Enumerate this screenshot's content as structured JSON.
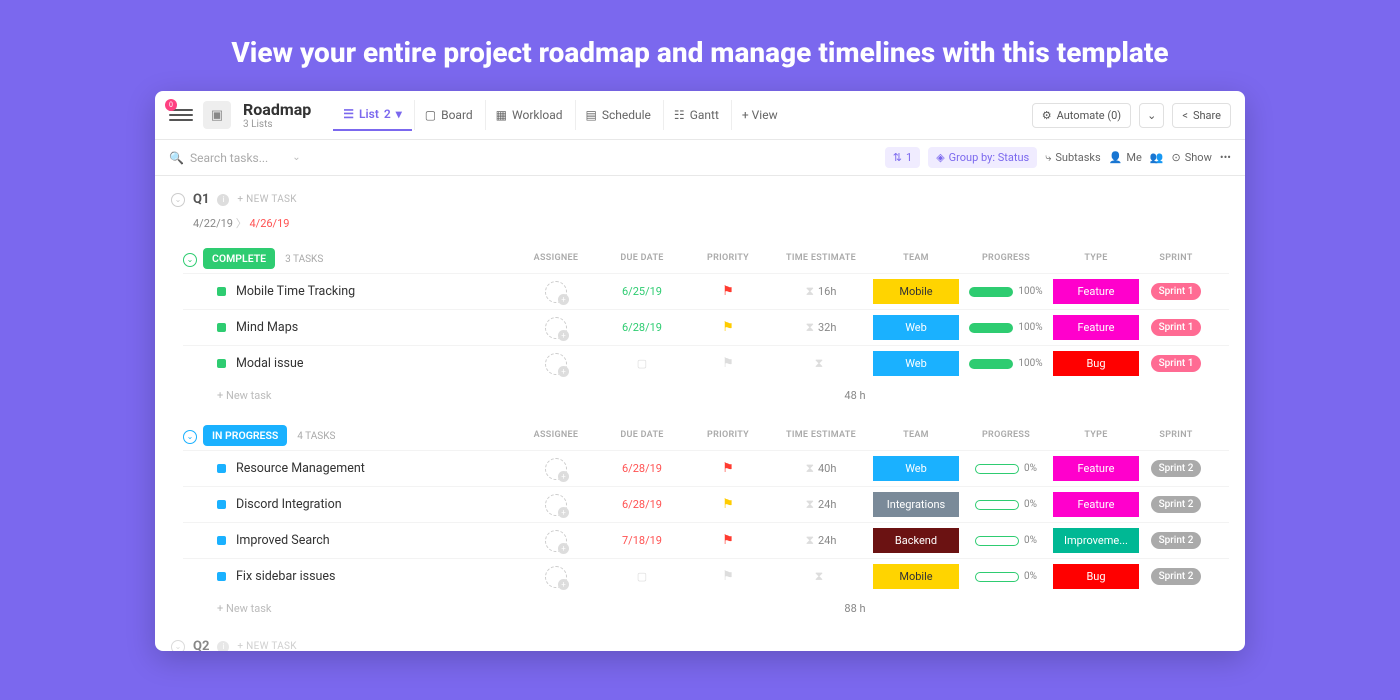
{
  "hero": "View your entire project roadmap and manage timelines with this template",
  "header": {
    "title": "Roadmap",
    "subtitle": "3 Lists",
    "views": {
      "list": "List",
      "list_n": "2",
      "board": "Board",
      "workload": "Workload",
      "schedule": "Schedule",
      "gantt": "Gantt",
      "add": "+ View"
    },
    "automate": "Automate (0)",
    "share": "Share"
  },
  "toolbar": {
    "search_placeholder": "Search tasks...",
    "filter_n": "1",
    "group_by": "Group by: Status",
    "subtasks": "Subtasks",
    "me": "Me",
    "show": "Show"
  },
  "columns": [
    "ASSIGNEE",
    "DUE DATE",
    "PRIORITY",
    "TIME ESTIMATE",
    "TEAM",
    "PROGRESS",
    "TYPE",
    "SPRINT"
  ],
  "q1": {
    "label": "Q1",
    "newtask": "+ NEW TASK",
    "date1": "4/22/19",
    "date2": "4/26/19"
  },
  "q2": {
    "label": "Q2",
    "newtask": "+ NEW TASK"
  },
  "groups": [
    {
      "status": "COMPLETE",
      "color": "green",
      "count": "3 TASKS",
      "total": "48 h",
      "tasks": [
        {
          "name": "Mobile Time Tracking",
          "due": "6/25/19",
          "due_cls": "",
          "flag": "red",
          "est": "16h",
          "team": "Mobile",
          "team_cls": "mobile",
          "prog": "100%",
          "prog_cls": "full",
          "type": "Feature",
          "type_cls": "type-feature",
          "sprint": "Sprint 1",
          "sprint_cls": "s1"
        },
        {
          "name": "Mind Maps",
          "due": "6/28/19",
          "due_cls": "",
          "flag": "yellow",
          "est": "32h",
          "team": "Web",
          "team_cls": "web",
          "prog": "100%",
          "prog_cls": "full",
          "type": "Feature",
          "type_cls": "type-feature",
          "sprint": "Sprint 1",
          "sprint_cls": "s1"
        },
        {
          "name": "Modal issue",
          "due": "",
          "due_cls": "none",
          "flag": "grey",
          "est": "",
          "team": "Web",
          "team_cls": "web",
          "prog": "100%",
          "prog_cls": "full",
          "type": "Bug",
          "type_cls": "type-bug",
          "sprint": "Sprint 1",
          "sprint_cls": "s1"
        }
      ],
      "newtask": "+ New task"
    },
    {
      "status": "IN PROGRESS",
      "color": "blue",
      "count": "4 TASKS",
      "total": "88 h",
      "tasks": [
        {
          "name": "Resource Management",
          "due": "6/28/19",
          "due_cls": "red",
          "flag": "red",
          "est": "40h",
          "team": "Web",
          "team_cls": "web",
          "prog": "0%",
          "prog_cls": "empty",
          "type": "Feature",
          "type_cls": "type-feature",
          "sprint": "Sprint 2",
          "sprint_cls": "s2"
        },
        {
          "name": "Discord Integration",
          "due": "6/28/19",
          "due_cls": "red",
          "flag": "yellow",
          "est": "24h",
          "team": "Integrations",
          "team_cls": "integrations",
          "prog": "0%",
          "prog_cls": "empty",
          "type": "Feature",
          "type_cls": "type-feature",
          "sprint": "Sprint 2",
          "sprint_cls": "s2"
        },
        {
          "name": "Improved Search",
          "due": "7/18/19",
          "due_cls": "red",
          "flag": "red",
          "est": "24h",
          "team": "Backend",
          "team_cls": "backend",
          "prog": "0%",
          "prog_cls": "empty",
          "type": "Improveme...",
          "type_cls": "type-improve",
          "sprint": "Sprint 2",
          "sprint_cls": "s2"
        },
        {
          "name": "Fix sidebar issues",
          "due": "",
          "due_cls": "none",
          "flag": "grey",
          "est": "",
          "team": "Mobile",
          "team_cls": "mobile",
          "prog": "0%",
          "prog_cls": "empty",
          "type": "Bug",
          "type_cls": "type-bug",
          "sprint": "Sprint 2",
          "sprint_cls": "s2"
        }
      ],
      "newtask": "+ New task"
    }
  ]
}
